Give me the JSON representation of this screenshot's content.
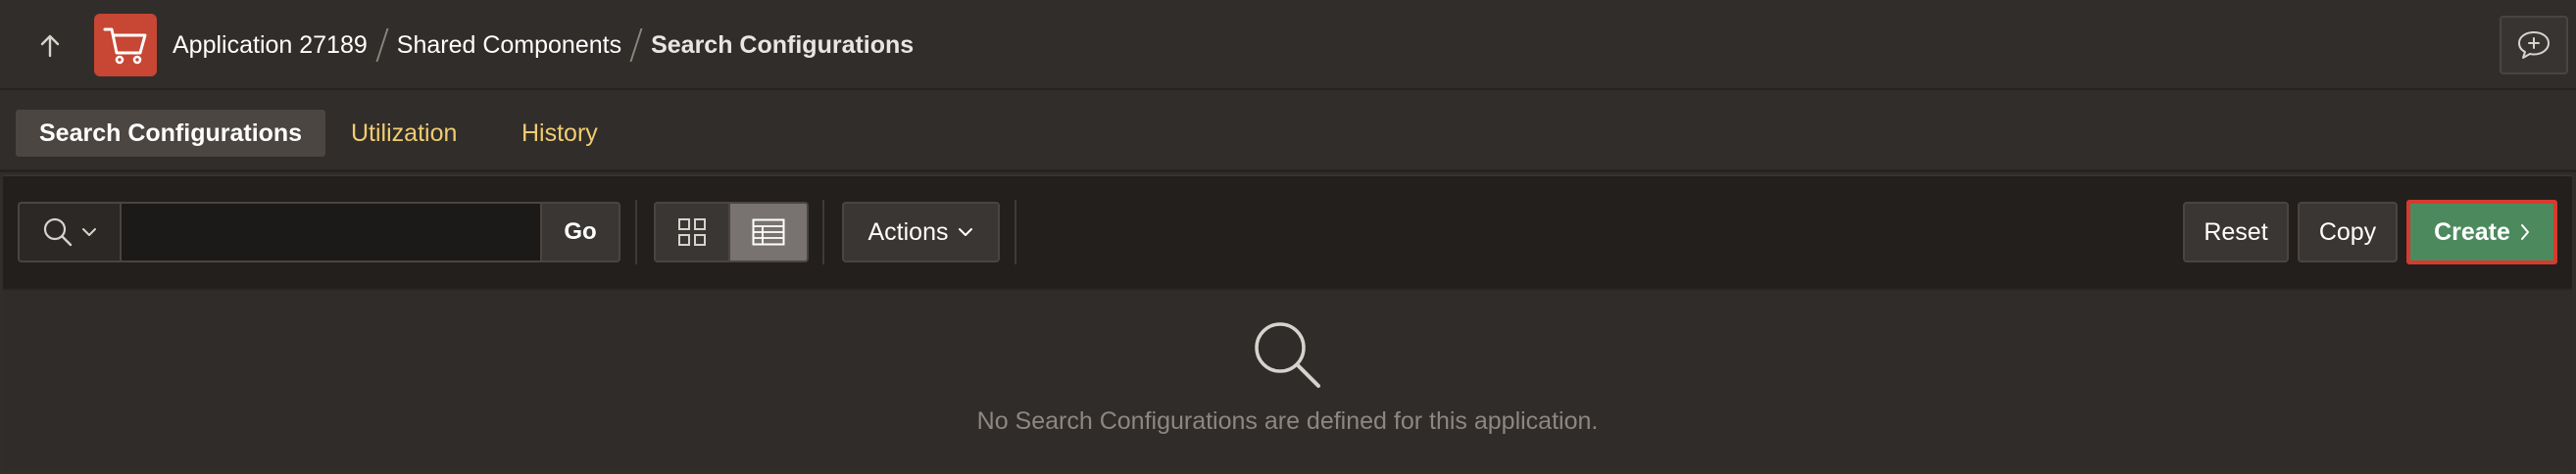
{
  "header": {
    "breadcrumb": {
      "app": "Application 27189",
      "shared": "Shared Components",
      "current": "Search Configurations"
    },
    "icons": {
      "up": "arrow-up-icon",
      "app": "shopping-cart-icon",
      "feedback": "chat-plus-icon"
    }
  },
  "tabs": {
    "active": "Search Configurations",
    "utilization": "Utilization",
    "history": "History"
  },
  "toolbar": {
    "search_value": "",
    "go_label": "Go",
    "actions_label": "Actions",
    "reset_label": "Reset",
    "copy_label": "Copy",
    "create_label": "Create"
  },
  "empty_state": {
    "message": "No Search Configurations are defined for this application."
  },
  "colors": {
    "background": "#312d2a",
    "toolbar": "#221f1d",
    "app_icon": "#c74634",
    "tab_link": "#f0cc71",
    "create_button": "#4c8a5e",
    "highlight_border": "#d73a2e"
  }
}
